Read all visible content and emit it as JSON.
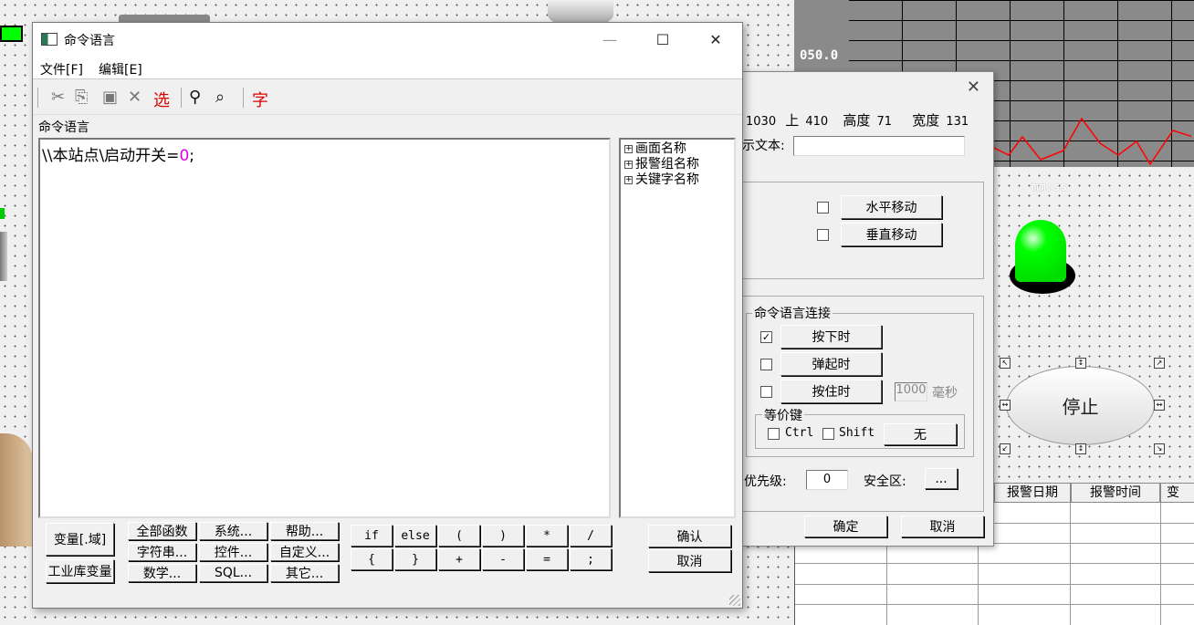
{
  "background": {
    "trend_label": "050.0",
    "trend_time_format": "mm:ss",
    "stop_button_label": "停止",
    "alarm_table": {
      "columns": [
        "报警日期",
        "报警时间",
        "变"
      ]
    }
  },
  "props_dialog": {
    "close_symbol": "✕",
    "dims": {
      "left_value": "1030",
      "top_label": "上",
      "top_value": "410",
      "height_label": "高度",
      "height_value": "71",
      "width_label": "宽度",
      "width_value": "131"
    },
    "text_label": "示文本:",
    "text_value": "",
    "move": {
      "horizontal_label": "水平移动",
      "vertical_label": "垂直移动"
    },
    "command_group": {
      "title": "命令语言连接",
      "press_label": "按下时",
      "press_checked": "✓",
      "release_label": "弹起时",
      "hold_label": "按住时",
      "hold_ms": "1000",
      "ms_unit": "毫秒"
    },
    "hotkey": {
      "title": "等价键",
      "ctrl": "Ctrl",
      "shift": "Shift",
      "key_label": "无"
    },
    "priority_label": "优先级:",
    "priority_value": "0",
    "security_label": "安全区:",
    "security_button": "...",
    "ok_label": "确定",
    "cancel_label": "取消"
  },
  "main_dialog": {
    "title": "命令语言",
    "minimize": "—",
    "maximize": "☐",
    "close": "✕",
    "menu": [
      "文件[F]",
      "编辑[E]"
    ],
    "toolbar": {
      "cut": "✂",
      "copy": "⎘",
      "paste": "▣",
      "delete": "✕",
      "select": "选",
      "find": "⚲",
      "replace": "⌕",
      "font": "字"
    },
    "section_label": "命令语言",
    "code_prefix": "\\\\本站点\\启动开关=",
    "code_value": "0",
    "code_suffix": ";",
    "tree": [
      "画面名称",
      "报警组名称",
      "关键字名称"
    ],
    "buttons": {
      "var_domain": "变量[.域]",
      "industrial_var": "工业库变量",
      "all_functions": "全部函数",
      "system": "系统...",
      "help": "帮助...",
      "string": "字符串...",
      "control": "控件...",
      "custom": "自定义...",
      "math": "数学...",
      "sql": "SQL...",
      "other": "其它...",
      "ok": "确认",
      "cancel": "取消"
    },
    "symbols_row1": [
      "if",
      "else",
      "(",
      ")",
      "*",
      "/"
    ],
    "symbols_row2": [
      "{",
      "}",
      "+",
      "-",
      "=",
      ";"
    ]
  }
}
